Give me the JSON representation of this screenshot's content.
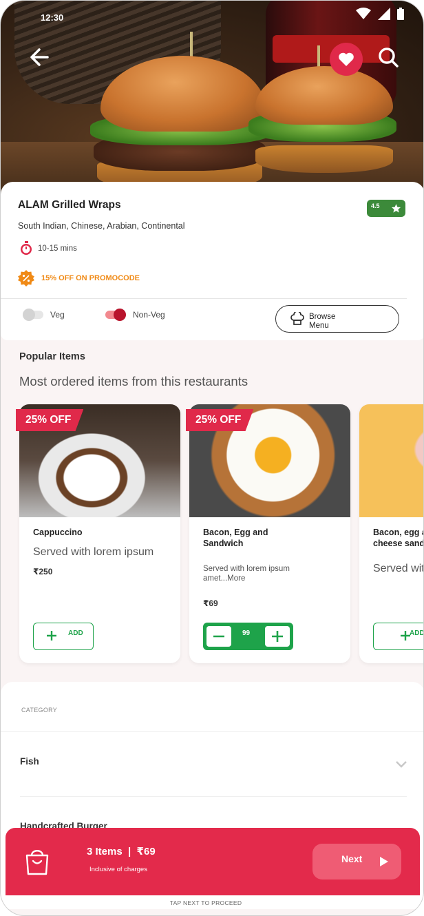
{
  "status": {
    "time": "12:30"
  },
  "restaurant": {
    "name": "ALAM Grilled Wraps",
    "cuisine": "South Indian, Chinese, Arabian, Continental",
    "rating": "4.5",
    "time": "10-15 mins",
    "promo": "15% OFF ON PROMOCODE"
  },
  "filters": {
    "veg_label": "Veg",
    "nonveg_label": "Non-Veg",
    "veg_on": false,
    "nonveg_on": true
  },
  "browse_menu": {
    "label": "Browse Menu"
  },
  "popular": {
    "title": "Popular Items",
    "subtitle": "Most ordered items from this restaurants",
    "items": [
      {
        "badge": "25% OFF",
        "name": "Cappuccino",
        "desc": "Served with lorem ipsum",
        "price": "₹250",
        "add_label": "ADD"
      },
      {
        "badge": "25% OFF",
        "name": "Bacon, Egg and Sandwich",
        "desc": "Served with lorem ipsum amet...More",
        "price": "₹69",
        "qty": "99"
      },
      {
        "name": "Bacon, egg and cheese sandwich",
        "desc": "Served with lorem ipsum",
        "add_label": "ADD"
      }
    ]
  },
  "category": {
    "heading": "CATEGORY",
    "items": [
      "Fish",
      "Handcrafted Burger"
    ]
  },
  "cart": {
    "summary": "3 Items  |  ₹69",
    "note": "Inclusive of charges",
    "next_label": "Next",
    "hint": "TAP NEXT TO PROCEED"
  },
  "colors": {
    "accent": "#e32a4b",
    "green": "#1ea34a",
    "rating_bg": "#3c8a3a",
    "promo": "#f08a16"
  },
  "icons": [
    "back-arrow-icon",
    "heart-icon",
    "search-icon",
    "star-icon",
    "timer-icon",
    "discount-icon",
    "chef-hat-icon",
    "plus-icon",
    "minus-icon",
    "chevron-down-icon",
    "shopping-bag-icon",
    "play-icon"
  ]
}
